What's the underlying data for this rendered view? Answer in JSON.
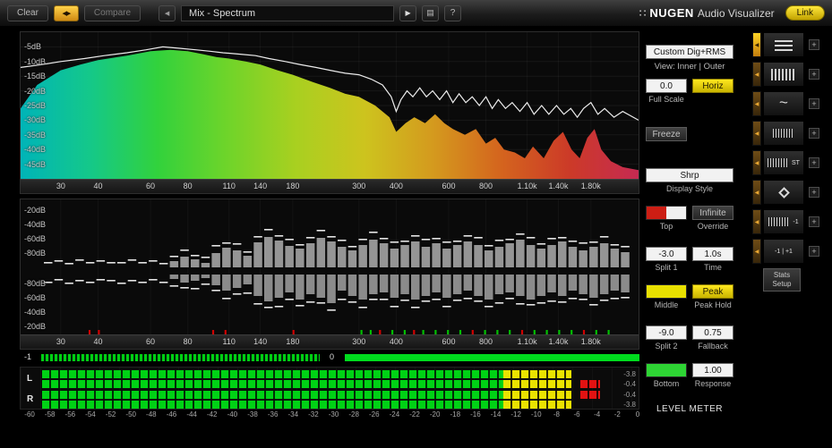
{
  "toolbar": {
    "clear_label": "Clear",
    "compare_label": "Compare",
    "title": "Mix - Spectrum",
    "brand_name": "NUGEN",
    "brand_suffix": "Audio Visualizer",
    "link_label": "Link",
    "help_label": "?"
  },
  "icons": {
    "swap": "◀▶",
    "prev": "◀",
    "play": "▶",
    "list": "▤",
    "plus": "+",
    "preset_arrow": "◀",
    "brand_dots": "∷"
  },
  "spectrum": {
    "db_label_texts": [
      "-5dB",
      "-10dB",
      "-15dB",
      "-20dB",
      "-25dB",
      "-30dB",
      "-35dB",
      "-40dB",
      "-45dB"
    ],
    "db_label_values": [
      -5,
      -10,
      -15,
      -20,
      -25,
      -30,
      -35,
      -40,
      -45
    ],
    "freq_label_texts": [
      "30",
      "40",
      "60",
      "80",
      "110",
      "140",
      "180",
      "300",
      "400",
      "600",
      "800",
      "1.10k",
      "1.40k",
      "1.80k"
    ],
    "freq_label_values": [
      30,
      40,
      60,
      80,
      110,
      140,
      180,
      300,
      400,
      600,
      800,
      1100,
      1400,
      1800
    ],
    "gradient": [
      "#00b4b8",
      "#14c88a",
      "#32d23c",
      "#6ed42a",
      "#a8d020",
      "#cdc41e",
      "#d49a1e",
      "#d4641e",
      "#cc3a28",
      "#c62a52"
    ],
    "fill_points": [
      [
        22,
        -26
      ],
      [
        25,
        -18
      ],
      [
        30,
        -13
      ],
      [
        35,
        -11
      ],
      [
        40,
        -9.5
      ],
      [
        50,
        -8
      ],
      [
        60,
        -6.5
      ],
      [
        70,
        -6
      ],
      [
        80,
        -6.5
      ],
      [
        90,
        -7.5
      ],
      [
        100,
        -8.5
      ],
      [
        110,
        -9
      ],
      [
        125,
        -10
      ],
      [
        140,
        -11
      ],
      [
        160,
        -13
      ],
      [
        180,
        -14.5
      ],
      [
        210,
        -17
      ],
      [
        240,
        -19
      ],
      [
        270,
        -21
      ],
      [
        300,
        -22
      ],
      [
        340,
        -25
      ],
      [
        380,
        -29
      ],
      [
        400,
        -34
      ],
      [
        430,
        -31
      ],
      [
        460,
        -29
      ],
      [
        500,
        -31
      ],
      [
        540,
        -28
      ],
      [
        580,
        -31
      ],
      [
        620,
        -33
      ],
      [
        680,
        -35
      ],
      [
        740,
        -33
      ],
      [
        800,
        -38
      ],
      [
        860,
        -36
      ],
      [
        920,
        -40
      ],
      [
        1000,
        -41
      ],
      [
        1080,
        -43
      ],
      [
        1150,
        -39
      ],
      [
        1250,
        -43
      ],
      [
        1350,
        -37
      ],
      [
        1450,
        -34
      ],
      [
        1550,
        -40
      ],
      [
        1650,
        -43
      ],
      [
        1750,
        -36
      ],
      [
        1850,
        -33
      ],
      [
        1950,
        -40
      ],
      [
        2100,
        -44
      ],
      [
        2300,
        -46
      ],
      [
        2600,
        -47
      ]
    ],
    "line_points": [
      [
        22,
        -12
      ],
      [
        26,
        -11
      ],
      [
        30,
        -10
      ],
      [
        36,
        -9
      ],
      [
        42,
        -8
      ],
      [
        50,
        -7
      ],
      [
        58,
        -6
      ],
      [
        66,
        -5
      ],
      [
        75,
        -5.5
      ],
      [
        85,
        -6
      ],
      [
        95,
        -6.5
      ],
      [
        105,
        -7
      ],
      [
        120,
        -7.5
      ],
      [
        135,
        -8
      ],
      [
        150,
        -9
      ],
      [
        170,
        -10
      ],
      [
        190,
        -11
      ],
      [
        215,
        -12
      ],
      [
        240,
        -13
      ],
      [
        270,
        -14
      ],
      [
        300,
        -14.5
      ],
      [
        330,
        -16
      ],
      [
        360,
        -18
      ],
      [
        385,
        -22
      ],
      [
        400,
        -27
      ],
      [
        415,
        -23
      ],
      [
        435,
        -20
      ],
      [
        455,
        -22
      ],
      [
        480,
        -19
      ],
      [
        505,
        -22
      ],
      [
        530,
        -20
      ],
      [
        560,
        -23
      ],
      [
        590,
        -20
      ],
      [
        620,
        -24
      ],
      [
        650,
        -21
      ],
      [
        685,
        -24
      ],
      [
        720,
        -22
      ],
      [
        760,
        -25
      ],
      [
        800,
        -22
      ],
      [
        840,
        -26
      ],
      [
        880,
        -23
      ],
      [
        930,
        -26
      ],
      [
        980,
        -24
      ],
      [
        1040,
        -27
      ],
      [
        1100,
        -24
      ],
      [
        1160,
        -28
      ],
      [
        1230,
        -25
      ],
      [
        1300,
        -28
      ],
      [
        1380,
        -25
      ],
      [
        1460,
        -28
      ],
      [
        1540,
        -26
      ],
      [
        1620,
        -29
      ],
      [
        1700,
        -26
      ],
      [
        1800,
        -24
      ],
      [
        1900,
        -28
      ],
      [
        2000,
        -26
      ],
      [
        2150,
        -29
      ],
      [
        2300,
        -27
      ],
      [
        2600,
        -30
      ]
    ]
  },
  "histogram": {
    "db_label_texts": [
      "-20dB",
      "-40dB",
      "-60dB",
      "-80dB",
      "-80dB",
      "-60dB",
      "-40dB",
      "-20dB"
    ],
    "freq_label_texts": [
      "30",
      "40",
      "60",
      "80",
      "110",
      "140",
      "180",
      "300",
      "400",
      "600",
      "800",
      "1.10k",
      "1.40k",
      "1.80k"
    ],
    "freq_label_values": [
      30,
      40,
      60,
      80,
      110,
      140,
      180,
      300,
      400,
      600,
      800,
      1100,
      1400,
      1800
    ],
    "bar_up": [
      1,
      2,
      1,
      2,
      1,
      2,
      2,
      1,
      2,
      1,
      2,
      1,
      7,
      12,
      9,
      5,
      16,
      22,
      19,
      13,
      28,
      34,
      30,
      24,
      21,
      27,
      33,
      29,
      23,
      19,
      25,
      31,
      27,
      21,
      25,
      29,
      23,
      27,
      21,
      25,
      29,
      25,
      19,
      23,
      27,
      31,
      25,
      21,
      25,
      29,
      23,
      19,
      23,
      27,
      21,
      17
    ],
    "bar_down": [
      2,
      1,
      2,
      1,
      2,
      1,
      1,
      2,
      1,
      2,
      1,
      2,
      5,
      9,
      7,
      4,
      12,
      18,
      15,
      11,
      24,
      30,
      26,
      20,
      28,
      22,
      26,
      32,
      18,
      24,
      28,
      22,
      20,
      26,
      22,
      28,
      24,
      20,
      26,
      22,
      18,
      24,
      28,
      22,
      20,
      24,
      28,
      24,
      20,
      24,
      18,
      22,
      26,
      22,
      18,
      20
    ],
    "peak_up": [
      5,
      6,
      4,
      7,
      5,
      6,
      4,
      5,
      7,
      5,
      6,
      4,
      6,
      8,
      5,
      7,
      9,
      6,
      8,
      5,
      7,
      9,
      6,
      8,
      5,
      7,
      9,
      6,
      8,
      5,
      7,
      9,
      6,
      8,
      5,
      7,
      9,
      6,
      8,
      5,
      7,
      9,
      6,
      8,
      5,
      7,
      9,
      6,
      8,
      5,
      7,
      9,
      6,
      8,
      5,
      7
    ],
    "peak_down": [
      6,
      4,
      7,
      5,
      6,
      4,
      5,
      7,
      5,
      6,
      4,
      6,
      7,
      5,
      8,
      6,
      5,
      8,
      6,
      9,
      8,
      6,
      9,
      7,
      6,
      8,
      5,
      7,
      9,
      6,
      8,
      5,
      7,
      9,
      6,
      8,
      5,
      7,
      9,
      6,
      8,
      5,
      7,
      9,
      6,
      8,
      5,
      7,
      9,
      6,
      8,
      5,
      7,
      6,
      8,
      5
    ],
    "baseline_ticks": [
      [
        11,
        "#d00000"
      ],
      [
        12.5,
        "#d00000"
      ],
      [
        31,
        "#d00000"
      ],
      [
        33,
        "#d00000"
      ],
      [
        44,
        "#d00000"
      ],
      [
        55,
        "#00c000"
      ],
      [
        56.5,
        "#00c000"
      ],
      [
        58,
        "#d00000"
      ],
      [
        60,
        "#00c000"
      ],
      [
        62,
        "#00c000"
      ],
      [
        63.5,
        "#d00000"
      ],
      [
        65,
        "#00c000"
      ],
      [
        67,
        "#00c000"
      ],
      [
        69,
        "#00c000"
      ],
      [
        71,
        "#00c000"
      ],
      [
        73,
        "#d00000"
      ],
      [
        75,
        "#00c000"
      ],
      [
        77,
        "#00c000"
      ],
      [
        79,
        "#00c000"
      ],
      [
        81,
        "#d00000"
      ],
      [
        83,
        "#00c000"
      ],
      [
        85,
        "#00c000"
      ],
      [
        87,
        "#00c000"
      ],
      [
        89,
        "#00c000"
      ],
      [
        91,
        "#d00000"
      ],
      [
        93,
        "#00c000"
      ],
      [
        95,
        "#00c000"
      ]
    ]
  },
  "correlation": {
    "min_label": "-1",
    "zero_label": "0"
  },
  "meter": {
    "channel_labels": [
      "L",
      "R"
    ],
    "green_pct": 80,
    "peak_from_pct": 93.3,
    "peak_to_pct": 96.8,
    "rows": [
      {
        "readout": "-3.8",
        "level_pct": 91.7,
        "peak": false
      },
      {
        "readout": "-0.4",
        "level_pct": 91.7,
        "peak": true
      },
      {
        "readout": "-0.4",
        "level_pct": 91.7,
        "peak": true
      },
      {
        "readout": "-3.8",
        "level_pct": 91.7,
        "peak": false
      }
    ],
    "scale_labels": [
      "-60",
      "-58",
      "-56",
      "-54",
      "-52",
      "-50",
      "-48",
      "-46",
      "-44",
      "-42",
      "-40",
      "-38",
      "-36",
      "-34",
      "-32",
      "-30",
      "-28",
      "-26",
      "-24",
      "-22",
      "-20",
      "-18",
      "-16",
      "-14",
      "-12",
      "-10",
      "-8",
      "-6",
      "-4",
      "-2",
      "0"
    ]
  },
  "controls": {
    "preset_name": "Custom Dig+RMS",
    "view_label": "View: Inner | Outer",
    "full_scale_value": "0.0",
    "horiz_label": "Horiz",
    "full_scale_label": "Full Scale",
    "freeze_label": "Freeze",
    "display_style_value": "Shrp",
    "display_style_label": "Display Style",
    "top_label": "Top",
    "override_value": "Infinite",
    "override_label": "Override",
    "split1_value": "-3.0",
    "split1_label": "Split 1",
    "time_value": "1.0s",
    "time_label": "Time",
    "middle_label": "Middle",
    "peak_hold_value": "Peak",
    "peak_hold_label": "Peak Hold",
    "split2_value": "-9.0",
    "split2_label": "Split 2",
    "fallback_value": "0.75",
    "fallback_label": "Fallback",
    "bottom_label": "Bottom",
    "response_value": "1.00",
    "response_label": "Response",
    "panel_caption": "LEVEL METER",
    "colors": {
      "top_swatch_left": "#cc1e14",
      "top_swatch_right": "#f0f0f0",
      "middle_swatch": "#e8e000",
      "bottom_swatch": "#2ed434"
    }
  },
  "presets": {
    "items": [
      {
        "icon": "hlines",
        "text": "",
        "selected": true
      },
      {
        "icon": "bars",
        "text": "",
        "selected": false
      },
      {
        "icon": "wave",
        "text": "",
        "selected": false
      },
      {
        "icon": "comb",
        "text": "",
        "selected": false
      },
      {
        "icon": "comb",
        "text": "ST",
        "selected": false
      },
      {
        "icon": "diamond",
        "text": "",
        "selected": false
      },
      {
        "icon": "comb",
        "text": "-1",
        "selected": false
      },
      {
        "icon": "none",
        "text": "-1 | +1",
        "selected": false
      }
    ],
    "stats_label": "Stats Setup"
  }
}
